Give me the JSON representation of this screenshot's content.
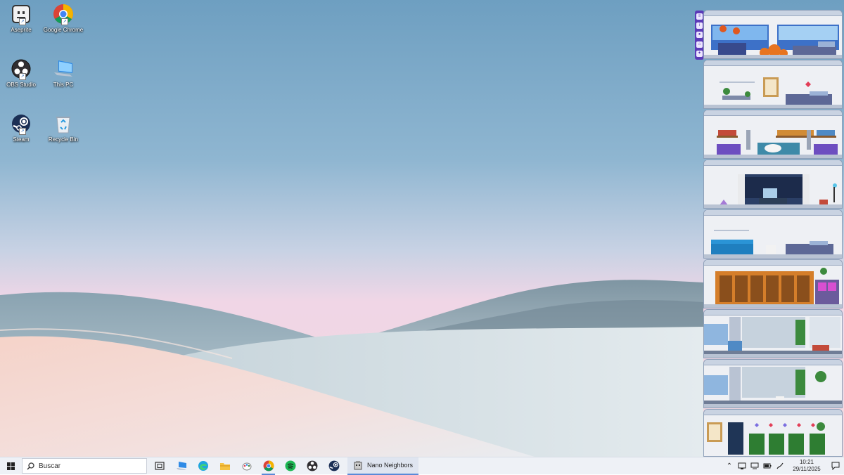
{
  "desktop_icons": [
    {
      "label": "Aseprite",
      "icon": "aseprite-icon"
    },
    {
      "label": "Google Chrome",
      "icon": "chrome-icon"
    },
    {
      "label": "OBS Studio",
      "icon": "obs-icon"
    },
    {
      "label": "This PC",
      "icon": "this-pc-icon"
    },
    {
      "label": "Steam",
      "icon": "steam-icon"
    },
    {
      "label": "Recycle Bin",
      "icon": "recycle-bin-icon"
    }
  ],
  "tower": {
    "floors": [
      "living-room-halloween",
      "bedroom",
      "library-lounge",
      "office-night-window",
      "living-room-sofa",
      "bookstore",
      "greenhouse-lab",
      "greenhouse",
      "arcade"
    ],
    "toolbar_icons": [
      "menu-icon",
      "info-icon",
      "user-icon",
      "home-icon",
      "settings-icon"
    ]
  },
  "taskbar": {
    "search_placeholder": "Buscar",
    "pinned": [
      "task-view-icon",
      "laptop-icon",
      "edge-icon",
      "file-explorer-icon",
      "paint-icon",
      "chrome-icon",
      "spotify-icon",
      "obs-icon",
      "steam-icon"
    ],
    "open_app_label": "Nano Neighbors",
    "tray_icons": [
      "chevron-up-icon",
      "network-icon",
      "battery-icon",
      "display-icon",
      "pen-icon"
    ],
    "time": "10:21",
    "date": "29/11/2025"
  },
  "colors": {
    "accent": "#5a8ad8",
    "widget_purple": "#5b3ab8"
  }
}
